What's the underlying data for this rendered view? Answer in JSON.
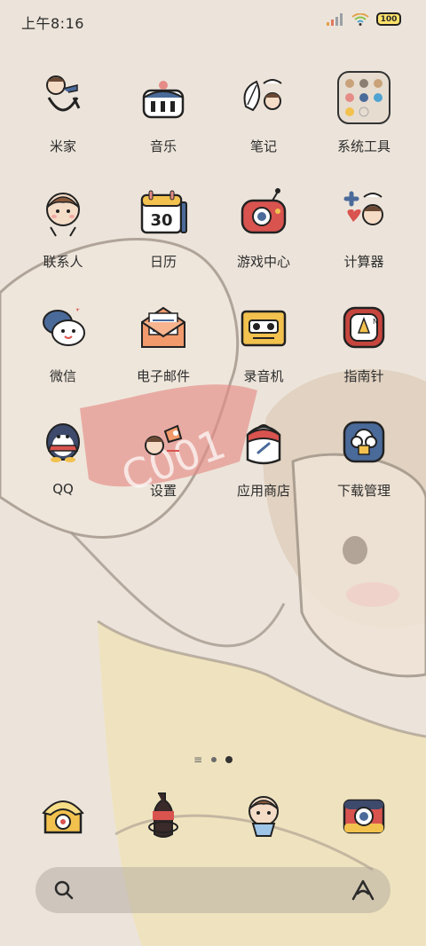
{
  "status_bar": {
    "time": "上午8:16",
    "battery": "100",
    "icons": [
      "signal-icon",
      "wifi-icon",
      "battery-icon"
    ]
  },
  "apps": [
    {
      "label": "米家",
      "icon": "mijia-icon"
    },
    {
      "label": "音乐",
      "icon": "music-icon"
    },
    {
      "label": "笔记",
      "icon": "notes-icon"
    },
    {
      "label": "系统工具",
      "icon": "system-tools-folder-icon"
    },
    {
      "label": "联系人",
      "icon": "contacts-icon"
    },
    {
      "label": "日历",
      "icon": "calendar-icon",
      "badge": "30"
    },
    {
      "label": "游戏中心",
      "icon": "game-center-icon"
    },
    {
      "label": "计算器",
      "icon": "calculator-icon"
    },
    {
      "label": "微信",
      "icon": "wechat-icon"
    },
    {
      "label": "电子邮件",
      "icon": "email-icon"
    },
    {
      "label": "录音机",
      "icon": "recorder-icon"
    },
    {
      "label": "指南针",
      "icon": "compass-icon"
    },
    {
      "label": "QQ",
      "icon": "qq-icon"
    },
    {
      "label": "设置",
      "icon": "settings-icon"
    },
    {
      "label": "应用商店",
      "icon": "app-store-icon"
    },
    {
      "label": "下载管理",
      "icon": "download-manager-icon"
    }
  ],
  "dock": [
    {
      "icon": "phone-icon"
    },
    {
      "icon": "messages-icon"
    },
    {
      "icon": "browser-icon"
    },
    {
      "icon": "camera-icon"
    }
  ],
  "pager": {
    "pages": 2,
    "current": 2
  },
  "colors": {
    "background": "#ece4da",
    "accent_red": "#d9534f",
    "accent_blue": "#4a6a9a",
    "accent_yellow": "#f2c14e"
  }
}
